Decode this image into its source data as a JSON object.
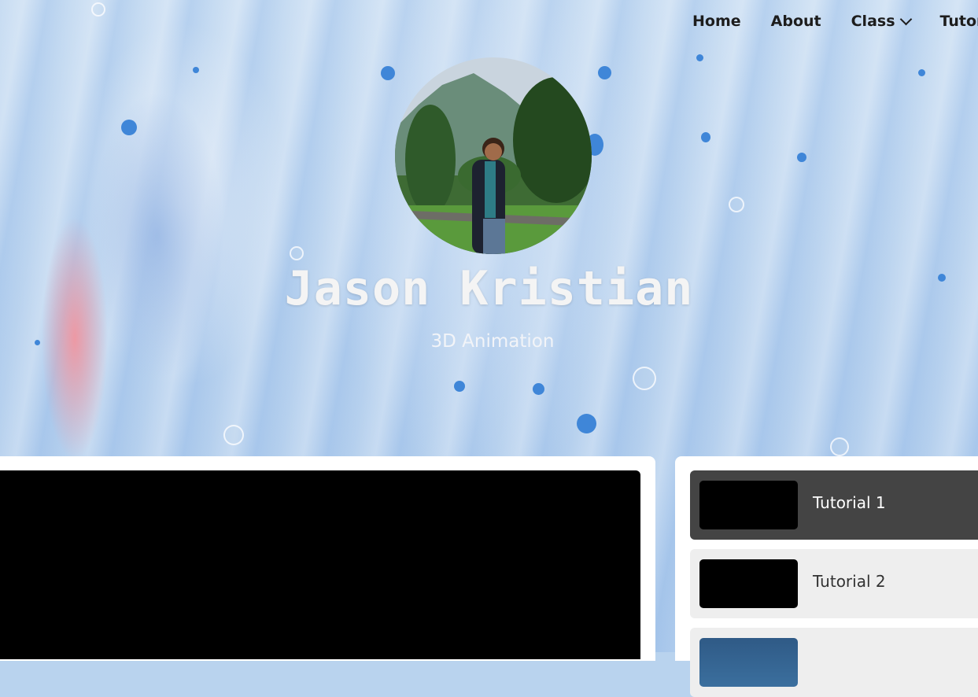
{
  "nav": {
    "items": [
      {
        "label": "Home"
      },
      {
        "label": "About"
      },
      {
        "label": "Class"
      },
      {
        "label": "Tutor"
      }
    ]
  },
  "profile": {
    "name": "Jason Kristian",
    "subtitle": "3D Animation"
  },
  "playlist": {
    "items": [
      {
        "label": "Tutorial 1",
        "active": true
      },
      {
        "label": "Tutorial 2",
        "active": false
      },
      {
        "label": "",
        "active": false
      }
    ]
  },
  "colors": {
    "background": "#b9d3ee",
    "nav_text": "#1d1d1d",
    "active_item": "#444444",
    "inactive_item": "#eeeeee",
    "video": "#000000"
  },
  "icons": {
    "class_dropdown": "chevron-down-icon"
  }
}
